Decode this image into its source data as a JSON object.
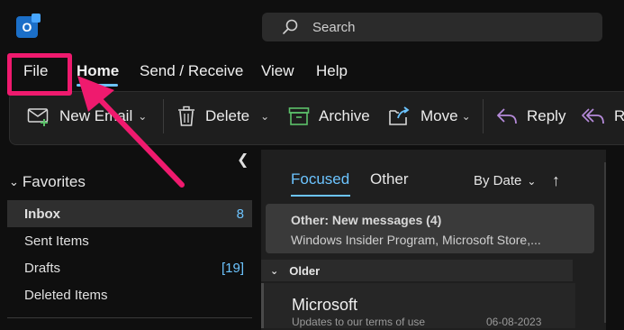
{
  "app": {
    "icon_letter": "O"
  },
  "search": {
    "placeholder": "Search"
  },
  "menu": {
    "file": "File",
    "home": "Home",
    "send_receive": "Send / Receive",
    "view": "View",
    "help": "Help"
  },
  "ribbon": {
    "new_email": "New Email",
    "delete": "Delete",
    "archive": "Archive",
    "move": "Move",
    "reply": "Reply",
    "reply_all": "R"
  },
  "favorites": {
    "header": "Favorites",
    "items": [
      {
        "label": "Inbox",
        "count": "8"
      },
      {
        "label": "Sent Items",
        "count": ""
      },
      {
        "label": "Drafts",
        "count": "[19]"
      },
      {
        "label": "Deleted Items",
        "count": ""
      }
    ]
  },
  "list": {
    "tab_focused": "Focused",
    "tab_other": "Other",
    "sort_label": "By Date",
    "notice_title": "Other: New messages (4)",
    "notice_body": "Windows Insider Program, Microsoft Store,...",
    "group_header": "Older",
    "message": {
      "sender": "Microsoft",
      "preview": "Updates to our terms of use",
      "date": "06-08-2023"
    }
  },
  "colors": {
    "accent": "#6cc4ff",
    "annotation": "#ef1a6e",
    "background": "#0f0f0f"
  },
  "icons": [
    "outlook-icon",
    "search-icon",
    "new-email-icon",
    "delete-icon",
    "archive-icon",
    "move-icon",
    "reply-icon",
    "reply-all-icon",
    "annotation-arrow-icon"
  ]
}
